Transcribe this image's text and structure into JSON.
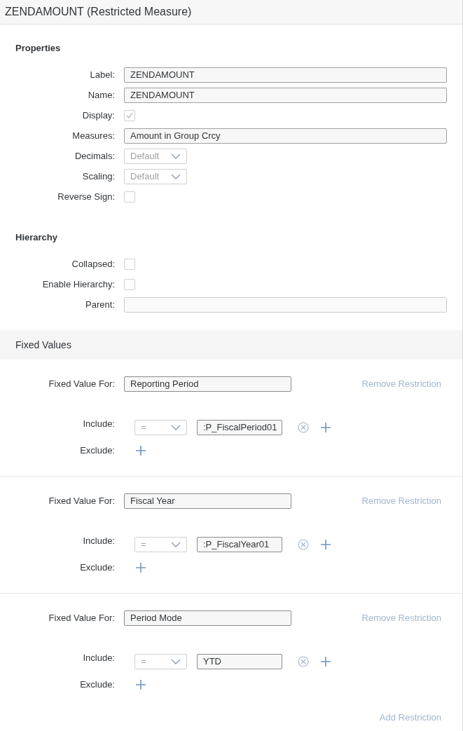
{
  "title": "ZENDAMOUNT (Restricted Measure)",
  "properties": {
    "heading": "Properties",
    "rows": [
      {
        "kind": "text",
        "label": "Label:",
        "value": "ZENDAMOUNT"
      },
      {
        "kind": "text",
        "label": "Name:",
        "value": "ZENDAMOUNT"
      },
      {
        "kind": "checkbox",
        "label": "Display:",
        "checked": true
      },
      {
        "kind": "text",
        "label": "Measures:",
        "value": "Amount in Group Crcy"
      },
      {
        "kind": "select",
        "label": "Decimals:",
        "value": "Default"
      },
      {
        "kind": "select",
        "label": "Scaling:",
        "value": "Default"
      },
      {
        "kind": "checkbox",
        "label": "Reverse Sign:",
        "checked": false
      }
    ]
  },
  "hierarchy": {
    "heading": "Hierarchy",
    "rows": [
      {
        "kind": "checkbox",
        "label": "Collapsed:",
        "checked": false
      },
      {
        "kind": "checkbox",
        "label": "Enable Hierarchy:",
        "checked": false
      },
      {
        "kind": "text",
        "label": "Parent:",
        "value": ""
      }
    ]
  },
  "fixed_values": {
    "heading": "Fixed Values",
    "restrictions": [
      {
        "label": "Fixed Value For:",
        "value": "Reporting Period",
        "remove": "Remove Restriction",
        "include_label": "Include:",
        "operator": "=",
        "include_value": ":P_FiscalPeriod01",
        "exclude_label": "Exclude:"
      },
      {
        "label": "Fixed Value For:",
        "value": "Fiscal Year",
        "remove": "Remove Restriction",
        "include_label": "Include:",
        "operator": "=",
        "include_value": ":P_FiscalYear01",
        "exclude_label": "Exclude:"
      },
      {
        "label": "Fixed Value For:",
        "value": "Period Mode",
        "remove": "Remove Restriction",
        "include_label": "Include:",
        "operator": "=",
        "include_value": "YTD",
        "exclude_label": "Exclude:"
      }
    ],
    "add": "Add Restriction"
  }
}
